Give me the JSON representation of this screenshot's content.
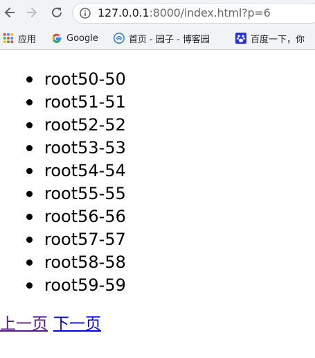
{
  "browser": {
    "url_host": "127.0.0.1",
    "url_path": ":8000/index.html?p=6",
    "nav_icons": [
      "back-arrow-icon",
      "forward-arrow-icon",
      "reload-icon",
      "info-icon"
    ]
  },
  "bookmarks": [
    {
      "label": "应用",
      "icon": "apps-grid-icon"
    },
    {
      "label": "Google",
      "icon": "google-icon"
    },
    {
      "label": "首页 - 园子 - 博客园",
      "icon": "cnblogs-icon"
    },
    {
      "label": "百度一下，你",
      "icon": "baidu-paw-icon"
    }
  ],
  "list": {
    "items": [
      "root50-50",
      "root51-51",
      "root52-52",
      "root53-53",
      "root54-54",
      "root55-55",
      "root56-56",
      "root57-57",
      "root58-58",
      "root59-59"
    ]
  },
  "pager": {
    "prev_label": "上一页",
    "next_label": "下一页"
  },
  "colors": {
    "visited_link": "#551a8b",
    "link": "#0000ee",
    "chrome_bg": "#f1f3f4"
  }
}
